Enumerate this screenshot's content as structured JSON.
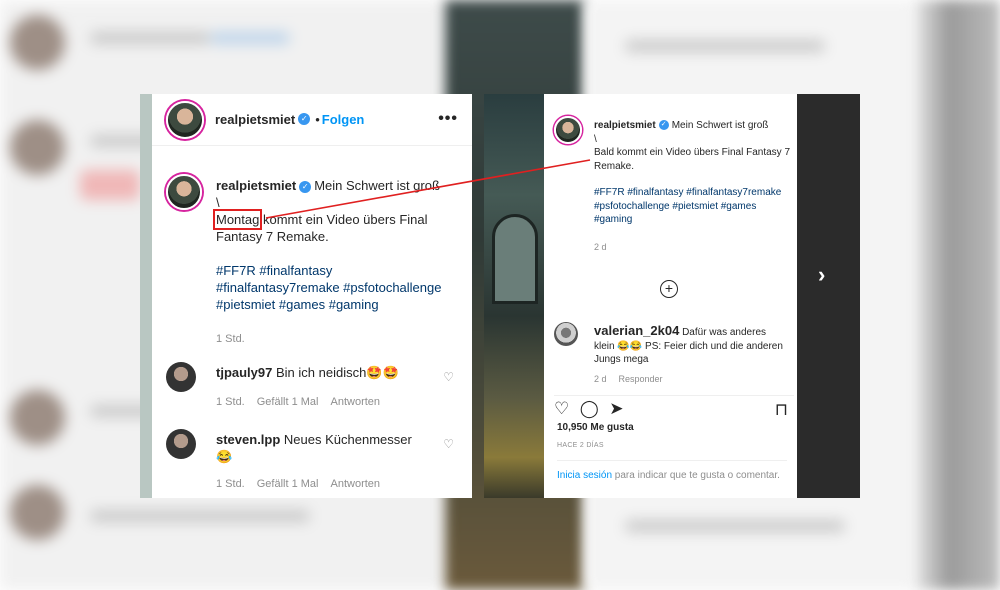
{
  "username": "realpietsmiet",
  "header": {
    "dot": "•",
    "follow_label": "Folgen",
    "more": "•••"
  },
  "caption": {
    "first_line": "Mein Schwert ist groß",
    "backslash": "\\",
    "highlighted_word": "Montag",
    "rest_line": " kommt ein Video übers Final Fantasy 7 Remake.",
    "hashtags": "#FF7R #finalfantasy #finalfantasy7remake #psfotochallenge #pietsmiet #games #gaming",
    "time": "1 Std."
  },
  "comments": [
    {
      "user": "tjpauly97",
      "text": "Bin ich neidisch🤩🤩",
      "time": "1 Std.",
      "likes": "Gefällt 1 Mal",
      "reply": "Antworten"
    },
    {
      "user": "steven.lpp",
      "text": "Neues Küchenmesser 😂",
      "time": "1 Std.",
      "likes": "Gefällt 1 Mal",
      "reply": "Antworten"
    }
  ],
  "right_post": {
    "first_line": "Mein Schwert ist groß",
    "backslash": "\\",
    "body": "Bald kommt ein Video übers Final Fantasy 7 Remake.",
    "hashtags": "#FF7R #finalfantasy #finalfantasy7remake #psfotochallenge #pietsmiet #games #gaming",
    "time": "2 d",
    "comment": {
      "user": "valerian_2k04",
      "text": "Dafür was anderes klein 😂😂 PS: Feier dich und die anderen Jungs mega",
      "time": "2 d",
      "reply": "Responder"
    },
    "likes": "10,950 Me gusta",
    "posted": "HACE 2 DÍAS",
    "login_link": "Inicia sesión",
    "login_rest": " para indicar que te gusta o comentar."
  },
  "colors": {
    "link": "#0095f6",
    "hashtag": "#00376b",
    "highlight": "#e02020",
    "story_ring": "#d6249f"
  }
}
